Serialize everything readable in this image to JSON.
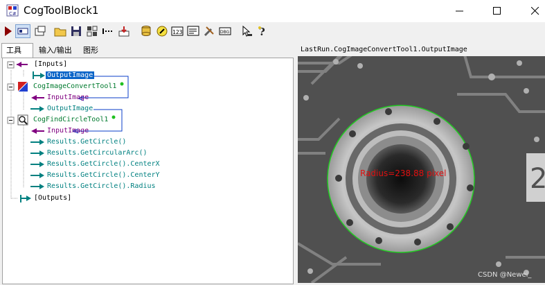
{
  "window": {
    "title": "CogToolBlock1"
  },
  "tabs": [
    "工具",
    "输入/输出",
    "图形"
  ],
  "tree": {
    "inputs_label": "[Inputs]",
    "inputs_output_image": "OutputImage",
    "convert_tool": "CogImageConvertTool1",
    "convert_input": "InputImage",
    "convert_output": "OutputImage",
    "find_tool": "CogFindCircleTool1",
    "find_input": "InputImage",
    "results": [
      "Results.GetCircle()",
      "Results.GetCircularArc()",
      "Results.GetCircle().CenterX",
      "Results.GetCircle().CenterY",
      "Results.GetCircle().Radius"
    ],
    "outputs_label": "[Outputs]"
  },
  "image": {
    "header": "LastRun.CogImageConvertTool1.OutputImage",
    "annotation": "Radius=238.88 pixel",
    "corner_glyph": "2",
    "watermark": "CSDN @Newei_"
  },
  "colors": {
    "circle": "#22cc22",
    "annotation": "#e01010",
    "selection": "#0a64c8",
    "link": "#0a3cc8"
  }
}
